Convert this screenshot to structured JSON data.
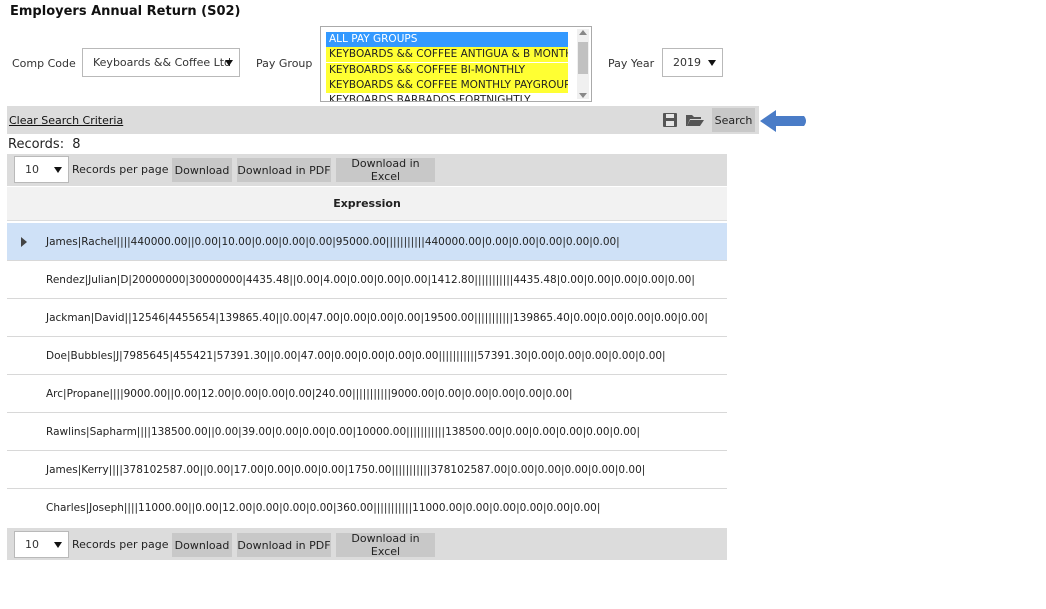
{
  "header": {
    "title": "Employers Annual Return (S02)"
  },
  "filters": {
    "comp_code_label": "Comp Code",
    "comp_code_value": "Keyboards && Coffee Ltd",
    "pay_group_label": "Pay Group",
    "pay_group_options": [
      "ALL PAY GROUPS",
      "KEYBOARDS && COFFEE ANTIGUA & B MONTHLY",
      "KEYBOARDS && COFFEE BI-MONTHLY",
      "KEYBOARDS && COFFEE MONTHLY PAYGROUP",
      "KEYBOARDS BARBADOS FORTNIGHTLY"
    ],
    "pay_year_label": "Pay Year",
    "pay_year_value": "2019"
  },
  "toolbar": {
    "clear_label": "Clear Search Criteria",
    "save_icon": "save-icon",
    "folder_icon": "folder-open-icon",
    "search_label": "Search",
    "arrow_color": "#4a7cc7"
  },
  "records": {
    "label": "Records:",
    "count": "8"
  },
  "pager": {
    "per_page_value": "10",
    "per_page_label": "Records per page",
    "download_label": "Download",
    "download_pdf_label": "Download in PDF",
    "download_excel_label": "Download in Excel"
  },
  "table": {
    "header": "Expression",
    "rows": [
      "James|Rachel||||440000.00||0.00|10.00|0.00|0.00|0.00|95000.00|||||||||||440000.00|0.00|0.00|0.00|0.00|0.00|",
      "Rendez|Julian|D|20000000|30000000|4435.48||0.00|4.00|0.00|0.00|0.00|1412.80|||||||||||4435.48|0.00|0.00|0.00|0.00|0.00|",
      "Jackman|David||12546|4455654|139865.40||0.00|47.00|0.00|0.00|0.00|19500.00|||||||||||139865.40|0.00|0.00|0.00|0.00|0.00|",
      "Doe|Bubbles|J|7985645|455421|57391.30||0.00|47.00|0.00|0.00|0.00|0.00|||||||||||57391.30|0.00|0.00|0.00|0.00|0.00|",
      "Arc|Propane||||9000.00||0.00|12.00|0.00|0.00|0.00|240.00|||||||||||9000.00|0.00|0.00|0.00|0.00|0.00|",
      "Rawlins|Sapharm||||138500.00||0.00|39.00|0.00|0.00|0.00|10000.00|||||||||||138500.00|0.00|0.00|0.00|0.00|0.00|",
      "James|Kerry||||378102587.00||0.00|17.00|0.00|0.00|0.00|1750.00|||||||||||378102587.00|0.00|0.00|0.00|0.00|0.00|",
      "Charles|Joseph||||11000.00||0.00|12.00|0.00|0.00|0.00|360.00|||||||||||11000.00|0.00|0.00|0.00|0.00|0.00|"
    ]
  },
  "colors": {
    "selected_option": "#3399ff",
    "highlight_option": "#ffff33",
    "active_row": "#cfe1f7",
    "toolbar_bg": "#dcdcdc"
  }
}
